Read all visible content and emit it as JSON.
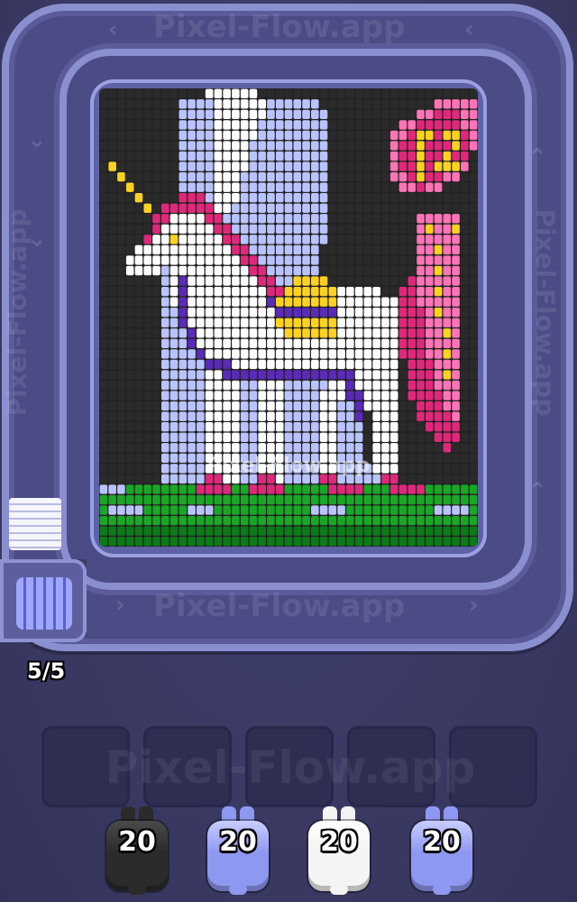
{
  "watermark": {
    "text": "Pixel-Flow.app"
  },
  "counter": {
    "text": "5/5"
  },
  "palette": {
    "K": "#2a2a2a",
    "W": "#ffffff",
    "L": "#b9c3ff",
    "B": "#8f98f0",
    "P": "#e0287a",
    "R": "#ff74b6",
    "Y": "#ffd21f",
    "V": "#5a2ab8",
    "G": "#19a726",
    "D": "#0b7a18"
  },
  "pixel_rows": [
    "KKKKKKKKKKKKWWWWWWKKKKKKKKKKKKKKKKKKKKKKKKK",
    "KKKKKKKKKLLLLWWWWWWLLLLLLKKKKKKKKKKKKKRRRRR",
    "KKKKKKKKKLLLLWWWWWWLLLLLLLKKKKKKKKKKRRPPPRR",
    "KKKKKKKKKLLLLWWWWWLLLLLLLLKKKKKKKKRRPPPPPRR",
    "KKKKKKKKKLLLLWWWWWLLLLLLLLKKKKKKKRRPYYPYYPR",
    "KKKKKKKKKLLLLWWWWLLLLLLLLLKKKKKKKRPPYPPPYPR",
    "KKKKKKKKKLLLLWWWWLLLLLLLLLKKKKKKKRPPYPPYPPK",
    "KYKKKKKKKLLLLWWWWLLLLLLLLLKKKKKKKRPPYPYYYRK",
    "KKYKKKKKKLLLLWWWLLLLLLLLLLKKKKKKKRRPYPPRRKK",
    "KKKYKKKKKLLLLWWWLLLLLLLLLLKKKKKKKKRRPRRKKKK",
    "KKKKYKKKKPPPLWWWLLLLLLLLLLKKKKKKKKKKKKKKKKK",
    "KKKKKYKPPPPPPWWLLLLLLLLLLLKKKKKKKKKKKKKKKKK",
    "KKKKKKPPWWWWPPLLLLLLLLLLLLKKKKKKKKKKRRRRRKK",
    "KKKKKKPWWWWWWPPLLLLLLLLLLLKKKKKKKKKKRYRRYKK",
    "KKKKKPWWYWWWWWPPLLLLLLLLLLKKKKKKKKKKRRRRRKK",
    "KKKKWWWWWWWWWWWPPLLLLLLLLKKKKKKKKKKKRRYRRKK",
    "KKKWWWWWWWWWWWWWPPLLLLLLLKKKKKKKKKKKRRRRRKK",
    "KKKWWWWLWWWWWWWWWPPLLLLLLKKKKKKKKKKKRRYRRKK",
    "KKKKKKKLWVWWWWWWWWPPLLYYYYKKKKKKKKKPRRRRRKK",
    "KKKKKKKLWVWWWWWWWWWPPYYYYYYWWWWWKKPPRRYRRKK",
    "KKKKKKKLWVWWWWWWWWWVYYYYYYYWWWWWWWPPRRRRRKK",
    "KKKKKKKLLVWWWWWWWWWWVVVVVVVWWWWWWWPPPRYRRKK",
    "KKKKKKKLLVWWWWWWWWWWYYYYYYYWWWWWWWPPPRRRRKK",
    "KKKKKKKLLLVWWWWWWWWWWYYYYYYWWWWWWWPPPRRYRKK",
    "KKKKKKKLLLVWWWWWWWWWWWWWWWWWWWWWWWPPPRRRRKK",
    "KKKKKKKLLLLVWWWWWWWWWWWWWWWWWWWWWWPPPRRYRKK",
    "KKKKKKKLLLLLVVVWWWWWWWWWWWWWWWWWWWKPPPRRRKK",
    "KKKKKKKLLLLLWWVVVVVVVVVVVVVVVWWWWWKPPPRYRKK",
    "KKKKKKKLLLLLWWWWLLWWWLLLLLWWVWWWWWKPPPRRRKK",
    "KKKKKKKLLLLLWWWWLLWWWLLLLWWWVVWWWWKPPPPRRKK",
    "KKKKKKKLLLLLWWWWLLWWWLLLLWWLLVWWWWKKPPPRRKK",
    "KKKKKKKLLLLLWWWWLLWWWLLLLWWLLVKWWWKKPPPPRKK",
    "KKKKKKKLLLLLWWWWLLWWWLLLLWWLLLKWWWKKKPPPPKK",
    "KKKKKKKLLLLLWWWWLLWWWLLLLWWLLLKWWWKKKKPPPKK",
    "KKKKKKKLLLLLWWWWLLWWWLLLLWWLLLKWWWKKKKKPKKK",
    "KKKKKKKLLLLLWWWWLLWWWLLLLWWLLLKWWWKKKKKKKKK",
    "KKKKKKKLLLLLWWWWLLWWWLLLLWWLLLLWWWKKKKKKKKK",
    "KKKKKKKLLLLLPPWWLLPPWLLLLPPLLLLLPPKKKKKKKKK",
    "LLLGGGGGGGGPPPPGGPPPPGGGGGPPPPGGGPPPPGGGGGG",
    "GGGGGGGGGGGGGGGGGGGGGGGGGGGGGGGGGGGGGGGGGGG",
    "GLLLLGGGGGLLLGGGGGGGGGGGLLLLGGGGGGGGGGLLLLG",
    "GGGGGGGGGGGGGGGGGGGGGGGGGGGGGGGGGGGGGGGGGGG",
    "DDDDDDDDDDDDDDDDDDDDDDDDDDDDDDDDDDDDDDDDDDD",
    "DDDDDDDDDDDDDDDDDDDDDDDDDDDDDDDDDDDDDDDDDDD"
  ],
  "shooters": [
    {
      "count": "20",
      "color": "#2b2b2b",
      "accent": "#4a4a4a",
      "name": "black"
    },
    {
      "count": "20",
      "color": "#8f98f0",
      "accent": "#c8ceff",
      "name": "blue"
    },
    {
      "count": "20",
      "color": "#f4f4f4",
      "accent": "#ffffff",
      "name": "white"
    },
    {
      "count": "20",
      "color": "#8f98f0",
      "accent": "#c8ceff",
      "name": "blue"
    }
  ],
  "slots": [
    "",
    "",
    "",
    "",
    ""
  ]
}
